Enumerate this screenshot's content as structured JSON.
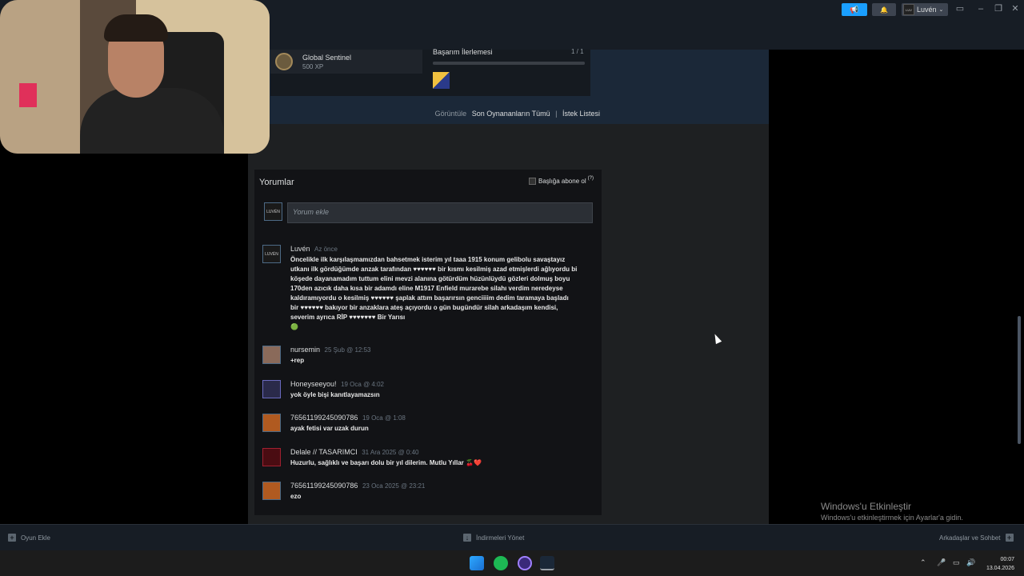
{
  "topbar": {
    "announcement_icon": "megaphone-icon",
    "notification_icon": "bell-icon",
    "account_name": "Luvén",
    "window_buttons": [
      "monitor-icon",
      "minimize-icon",
      "restore-icon",
      "close-icon"
    ]
  },
  "achievement": {
    "name": "Global Sentinel",
    "xp": "500 XP",
    "progress_label": "Başarım İlerlemesi",
    "progress_value": "1 / 1",
    "progress_fraction": 1.0
  },
  "view_links": {
    "label": "Görüntüle",
    "recent": "Son Oynananların Tümü",
    "wishlist": "İstek Listesi"
  },
  "comments": {
    "title": "Yorumlar",
    "subscribe_label": "Başlığa abone ol",
    "subscribe_help": "(?)",
    "input_placeholder": "Yorum ekle",
    "my_avatar_text": "LUVÉN",
    "items": [
      {
        "author": "Luvén",
        "time": "Az önce",
        "text": "Öncelikle ilk karşılaşmamızdan bahsetmek isterim yıl taaa 1915 konum gelibolu savaştayız utkanı ilk gördüğümde anzak tarafından ♥♥♥♥♥♥ bir kısmı kesilmiş azad etmişlerdi ağlıyordu bi köşede dayanamadım tuttum elini mevzi alanına götürdüm hüzünlüydü gözleri dolmuş boyu 170den azıcık daha kısa bir adamdı eline M1917 Enfield murarebe silahı verdim neredeyse kaldıramıyordu o kesilmiş ♥♥♥♥♥♥ şaplak attım başarırsın genciiiim dedim taramaya başladı bir ♥♥♥♥♥♥ bakıyor bir anzaklara ateş açıyordu o gün bugündür silah arkadaşım kendisi, severim ayrıca RİP ♥♥♥♥♥♥♥ Bir Yarısı",
        "emoji": "🟢",
        "avatar_text": "LUVÉN"
      },
      {
        "author": "nursemin",
        "time": "25 Şub @ 12:53",
        "text": "+rep"
      },
      {
        "author": "Honeyseeyou!",
        "time": "19 Oca @ 4:02",
        "text": "yok öyle bişi kanıtlayamazsın"
      },
      {
        "author": "76561199245090786",
        "time": "19 Oca @ 1:08",
        "text": "ayak fetisi var uzak durun"
      },
      {
        "author": "Delale // TASARIMCI",
        "time": "31 Ara 2025 @ 0:40",
        "text": "Huzurlu, sağlıklı ve başarı dolu bir yıl dilerim. Mutlu Yıllar 🍒❤️"
      },
      {
        "author": "76561199245090786",
        "time": "23 Oca 2025 @ 23:21",
        "text": "ezo"
      }
    ]
  },
  "bottombar": {
    "add_game": "Oyun Ekle",
    "downloads": "İndirmeleri Yönet",
    "friends": "Arkadaşlar ve Sohbet"
  },
  "activation": {
    "title": "Windows'u Etkinleştir",
    "subtitle": "Windows'u etkinleştirmek için Ayarlar'a gidin."
  },
  "taskbar": {
    "time": "00:07",
    "date": "13.04.2026",
    "apps": [
      "windows-start-icon",
      "spotify-icon",
      "app-circle-icon",
      "steam-icon"
    ]
  },
  "colors": {
    "steam_blue": "#1a9fff",
    "panel_dark": "#121316",
    "topbar": "#171d25"
  }
}
